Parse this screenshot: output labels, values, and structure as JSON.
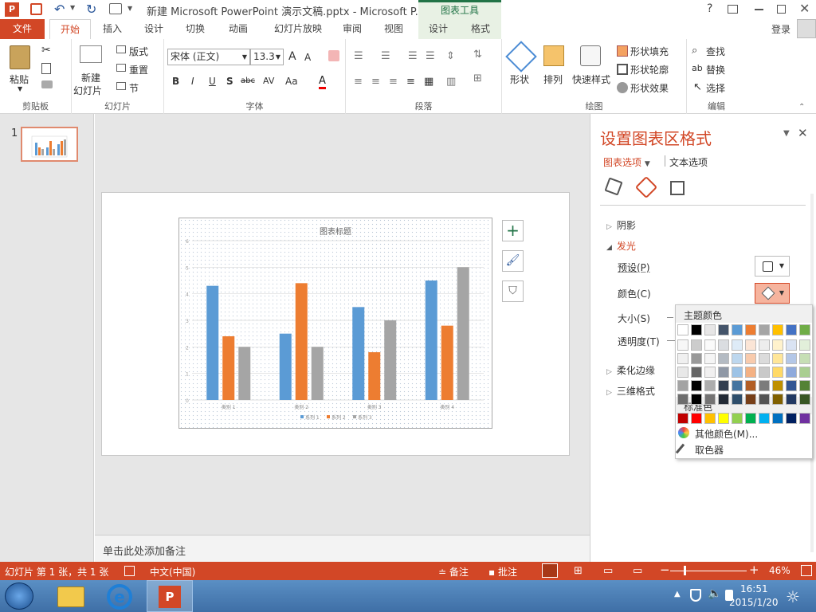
{
  "titlebar": {
    "title": "新建 Microsoft PowerPoint 演示文稿.pptx - Microsoft P...",
    "context_tab_group": "图表工具",
    "help": "?",
    "user": "登录"
  },
  "tabs": [
    "文件",
    "开始",
    "插入",
    "设计",
    "切换",
    "动画",
    "幻灯片放映",
    "审阅",
    "视图",
    "设计",
    "格式"
  ],
  "ribbon": {
    "clipboard": {
      "paste": "粘贴",
      "label": "剪贴板"
    },
    "slides": {
      "new_slide": "新建",
      "new_slide2": "幻灯片",
      "layout": "版式",
      "reset": "重置",
      "section": "节",
      "label": "幻灯片"
    },
    "font": {
      "font_name": "宋体 (正文)",
      "font_size": "13.3",
      "bold": "B",
      "italic": "I",
      "underline": "U",
      "shadow": "S",
      "strike": "abc",
      "spacing": "AV",
      "case": "Aa",
      "color": "A",
      "grow": "A",
      "shrink": "A",
      "label": "字体"
    },
    "paragraph": {
      "label": "段落"
    },
    "drawing": {
      "shape": "形状",
      "arrange": "排列",
      "quick_styles": "快速样式",
      "shape_fill": "形状填充",
      "shape_outline": "形状轮廓",
      "shape_effects": "形状效果",
      "label": "绘图"
    },
    "editing": {
      "find": "查找",
      "replace": "替换",
      "select": "选择",
      "label": "编辑"
    }
  },
  "slide_panel": {
    "number": "1"
  },
  "chart": {
    "title": "图表标题",
    "categories": [
      "类别 1",
      "类别 2",
      "类别 3",
      "类别 4"
    ],
    "legend": [
      "系列 1",
      "系列 2",
      "系列 3"
    ],
    "y_ticks": [
      "0",
      "1",
      "2",
      "3",
      "4",
      "5",
      "6"
    ]
  },
  "chart_data": {
    "type": "bar",
    "title": "图表标题",
    "categories": [
      "类别 1",
      "类别 2",
      "类别 3",
      "类别 4"
    ],
    "series": [
      {
        "name": "系列 1",
        "values": [
          4.3,
          2.5,
          3.5,
          4.5
        ]
      },
      {
        "name": "系列 2",
        "values": [
          2.4,
          4.4,
          1.8,
          2.8
        ]
      },
      {
        "name": "系列 3",
        "values": [
          2,
          2,
          3,
          5
        ]
      }
    ],
    "ylim": [
      0,
      6
    ],
    "grid": true,
    "legend_position": "bottom",
    "colors": [
      "#5b9bd5",
      "#ed7d31",
      "#a5a5a5"
    ]
  },
  "notes": {
    "placeholder": "单击此处添加备注"
  },
  "format_pane": {
    "title": "设置图表区格式",
    "tab_chart_options": "图表选项",
    "tab_text_options": "文本选项",
    "sections": {
      "shadow": "阴影",
      "glow": "发光",
      "soft_edges": "柔化边缘",
      "threed": "三维格式"
    },
    "glow": {
      "preset": "预设(P)",
      "color": "颜色(C)",
      "size": "大小(S)",
      "transparency": "透明度(T)"
    }
  },
  "color_dropdown": {
    "theme_colors_label": "主题颜色",
    "standard_colors_label": "标准色",
    "more_colors": "其他颜色(M)...",
    "eyedropper": "取色器",
    "theme_top": [
      "#ffffff",
      "#000000",
      "#e7e6e6",
      "#44546a",
      "#5b9bd5",
      "#ed7d31",
      "#a5a5a5",
      "#ffc000",
      "#4472c4",
      "#70ad47"
    ],
    "standard": [
      "#c00000",
      "#ff0000",
      "#ffc000",
      "#ffff00",
      "#92d050",
      "#00b050",
      "#00b0f0",
      "#0070c0",
      "#002060",
      "#7030a0"
    ]
  },
  "status": {
    "slide_info": "幻灯片 第 1 张，共 1 张",
    "language": "中文(中国)",
    "notes": "备注",
    "comments": "批注",
    "zoom": "46%"
  },
  "taskbar": {
    "time": "16:51",
    "date": "2015/1/20"
  }
}
